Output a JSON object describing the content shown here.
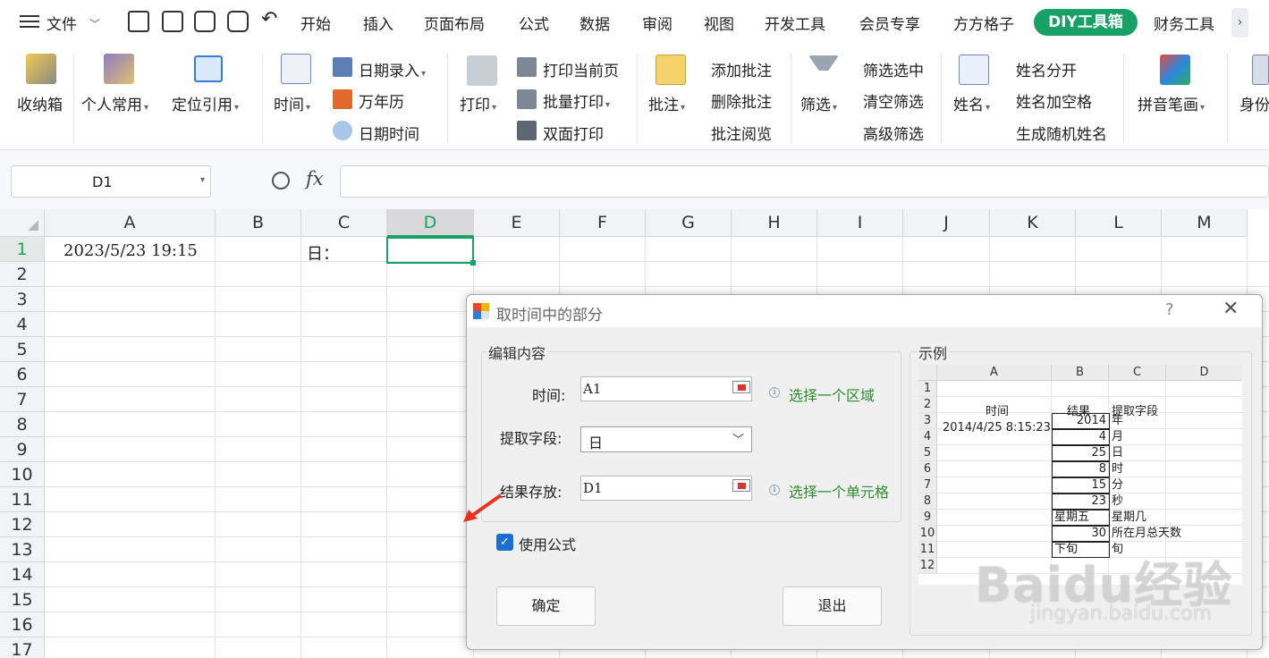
{
  "menu": {
    "file": "文件",
    "tabs": [
      "开始",
      "插入",
      "页面布局",
      "公式",
      "数据",
      "审阅",
      "视图",
      "开发工具",
      "会员专享",
      "方方格子"
    ],
    "active_tab": "DIY工具箱",
    "last_tab": "财务工具",
    "more": "›",
    "accent": "#18a167"
  },
  "ribbon": {
    "store": "收纳箱",
    "personal": "个人常用",
    "locate": "定位引用",
    "time": "时间",
    "date_entry": "日期录入",
    "perpetual_calendar": "万年历",
    "date_time": "日期时间",
    "print": "打印",
    "print_current": "打印当前页",
    "batch_print": "批量打印",
    "duplex_print": "双面打印",
    "comment": "批注",
    "add_comment": "添加批注",
    "delete_comment": "删除批注",
    "review_comment": "批注阅览",
    "filter": "筛选",
    "filter_selected": "筛选选中",
    "clear_filter": "清空筛选",
    "advanced_filter": "高级筛选",
    "name": "姓名",
    "split_name": "姓名分开",
    "name_space": "姓名加空格",
    "random_name": "生成随机姓名",
    "pinyin": "拼音笔画",
    "id_cut": "身份"
  },
  "formula_bar": {
    "cell_ref": "D1",
    "fx": "fx",
    "value": ""
  },
  "sheet": {
    "columns": [
      "A",
      "B",
      "C",
      "D",
      "E",
      "F",
      "G",
      "H",
      "I",
      "J",
      "K",
      "L",
      "M"
    ],
    "selected_column": "D",
    "rows": [
      "1",
      "2",
      "3",
      "4",
      "5",
      "6",
      "7",
      "8",
      "9",
      "10",
      "11",
      "12",
      "13",
      "14",
      "15",
      "16",
      "17"
    ],
    "selected_row": "1",
    "a1": "2023/5/23 19:15",
    "c1": "日："
  },
  "dialog": {
    "title": "取时间中的部分",
    "help": "?",
    "close": "✕",
    "edit_group": "编辑内容",
    "time_label": "时间:",
    "time_value": "A1",
    "time_hint": "选择一个区域",
    "field_label": "提取字段:",
    "field_value": "日",
    "result_label": "结果存放:",
    "result_value": "D1",
    "result_hint": "选择一个单元格",
    "use_formula": "使用公式",
    "use_formula_checked": true,
    "ok": "确定",
    "exit": "退出",
    "example_group": "示例",
    "example": {
      "cols": [
        "A",
        "B",
        "C",
        "D"
      ],
      "rows": [
        "1",
        "2",
        "3",
        "4",
        "5",
        "6",
        "7",
        "8",
        "9",
        "10",
        "11",
        "12"
      ],
      "h_time": "时间",
      "h_result": "结果",
      "h_field": "提取字段",
      "sample_time": "2014/4/25 8:15:23",
      "results": [
        "2014",
        "4",
        "25",
        "8",
        "15",
        "23",
        "星期五",
        "30",
        "下旬"
      ],
      "fields": [
        "年",
        "月",
        "日",
        "时",
        "分",
        "秒",
        "星期几",
        "所在月总天数",
        "旬"
      ]
    }
  },
  "watermark": {
    "brand": "Baidu经验",
    "url": "jingyan.baidu.com"
  }
}
